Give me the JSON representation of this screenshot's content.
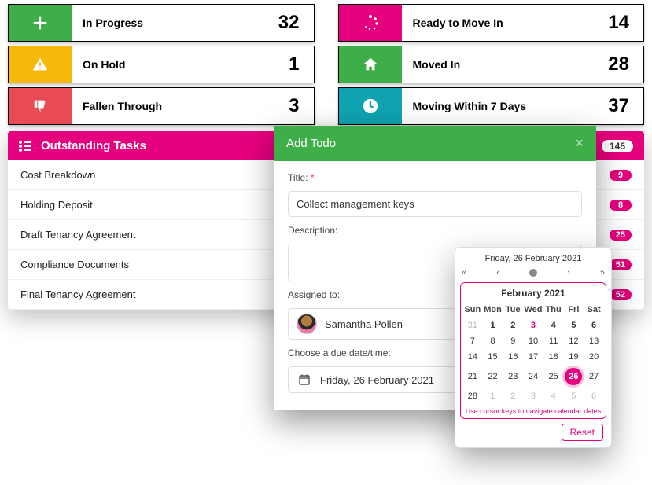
{
  "tiles": {
    "left": [
      {
        "label": "In Progress",
        "count": 32,
        "color": "green",
        "icon": "plus"
      },
      {
        "label": "On Hold",
        "count": 1,
        "color": "yellow",
        "icon": "alert"
      },
      {
        "label": "Fallen Through",
        "count": 3,
        "color": "red",
        "icon": "thumb-down"
      }
    ],
    "right": [
      {
        "label": "Ready to Move In",
        "count": 14,
        "color": "magenta",
        "icon": "loading"
      },
      {
        "label": "Moved In",
        "count": 28,
        "color": "green",
        "icon": "home"
      },
      {
        "label": "Moving Within 7 Days",
        "count": 37,
        "color": "teal",
        "icon": "clock"
      }
    ]
  },
  "tasks": {
    "title": "Outstanding Tasks",
    "total": 145,
    "items": [
      {
        "label": "Cost Breakdown",
        "count": 9
      },
      {
        "label": "Holding Deposit",
        "count": 8
      },
      {
        "label": "Draft Tenancy Agreement",
        "count": 25
      },
      {
        "label": "Compliance Documents",
        "count": 51
      },
      {
        "label": "Final Tenancy Agreement",
        "count": 52
      }
    ]
  },
  "modal": {
    "title": "Add Todo",
    "title_label": "Title:",
    "title_value": "Collect management keys",
    "desc_label": "Description:",
    "desc_value": "",
    "assigned_label": "Assigned to:",
    "assignee_name": "Samantha Pollen",
    "due_label": "Choose a due date/time:",
    "due_value": "Friday, 26 February 2021"
  },
  "calendar": {
    "header": "Friday, 26 February 2021",
    "month_label": "February 2021",
    "hint": "Use cursor keys to navigate calendar dates",
    "reset": "Reset",
    "dow": [
      "Sun",
      "Mon",
      "Tue",
      "Wed",
      "Thu",
      "Fri",
      "Sat"
    ],
    "weeks": [
      [
        {
          "d": 31,
          "muted": true
        },
        {
          "d": 1,
          "b": true
        },
        {
          "d": 2,
          "b": true
        },
        {
          "d": 3,
          "pink": true
        },
        {
          "d": 4,
          "b": true
        },
        {
          "d": 5,
          "b": true
        },
        {
          "d": 6,
          "b": true
        }
      ],
      [
        {
          "d": 7
        },
        {
          "d": 8
        },
        {
          "d": 9
        },
        {
          "d": 10
        },
        {
          "d": 11
        },
        {
          "d": 12
        },
        {
          "d": 13
        }
      ],
      [
        {
          "d": 14
        },
        {
          "d": 15
        },
        {
          "d": 16
        },
        {
          "d": 17
        },
        {
          "d": 18
        },
        {
          "d": 19
        },
        {
          "d": 20
        }
      ],
      [
        {
          "d": 21
        },
        {
          "d": 22
        },
        {
          "d": 23
        },
        {
          "d": 24
        },
        {
          "d": 25
        },
        {
          "d": 26,
          "sel": true
        },
        {
          "d": 27
        }
      ],
      [
        {
          "d": 28
        },
        {
          "d": 1,
          "muted": true
        },
        {
          "d": 2,
          "muted": true
        },
        {
          "d": 3,
          "muted": true
        },
        {
          "d": 4,
          "muted": true
        },
        {
          "d": 5,
          "muted": true
        },
        {
          "d": 6,
          "muted": true
        }
      ]
    ]
  }
}
